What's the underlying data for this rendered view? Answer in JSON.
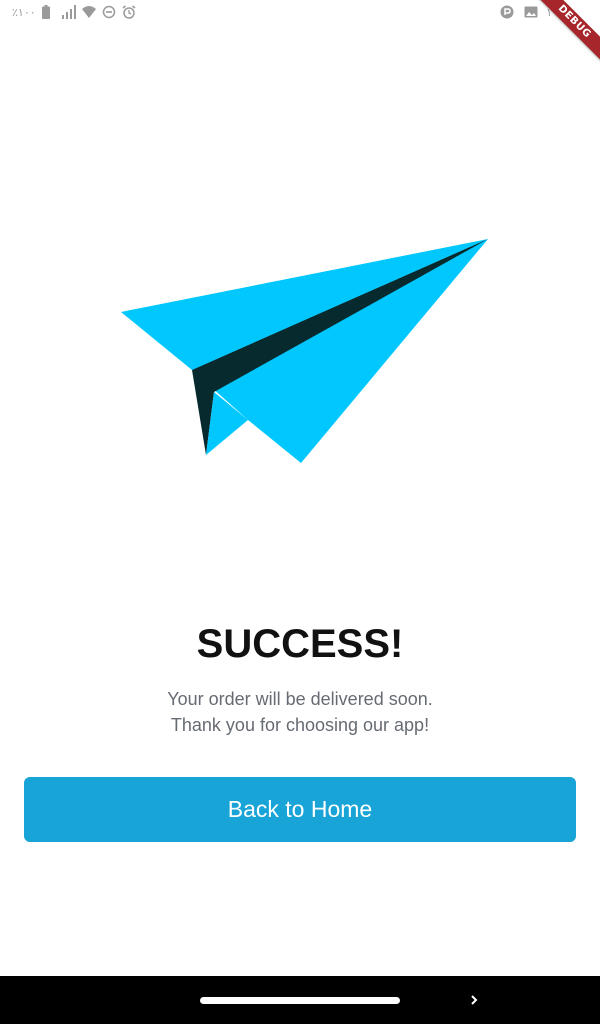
{
  "status_bar": {
    "battery_text": "٪١٠٠",
    "time_text": "١٩",
    "icons": [
      "battery-icon",
      "signal-icon",
      "wifi-icon",
      "dnd-icon",
      "alarm-icon",
      "parking-icon",
      "image-icon"
    ]
  },
  "debug_banner": {
    "label": "DEBUG"
  },
  "illustration": {
    "name": "paper-plane-icon",
    "primary_color": "#00c8ff",
    "shadow_color": "#062a2e"
  },
  "content": {
    "title": "SUCCESS!",
    "message_line1": "Your order will be delivered soon.",
    "message_line2": "Thank you for choosing our app!"
  },
  "actions": {
    "back_home_label": "Back to Home"
  },
  "colors": {
    "accent": "#18a4d6",
    "title": "#111111",
    "message": "#666b73",
    "debug": "#a6262b"
  },
  "nav_bar": {
    "icons": [
      "home-pill",
      "chevron-right-icon"
    ]
  }
}
